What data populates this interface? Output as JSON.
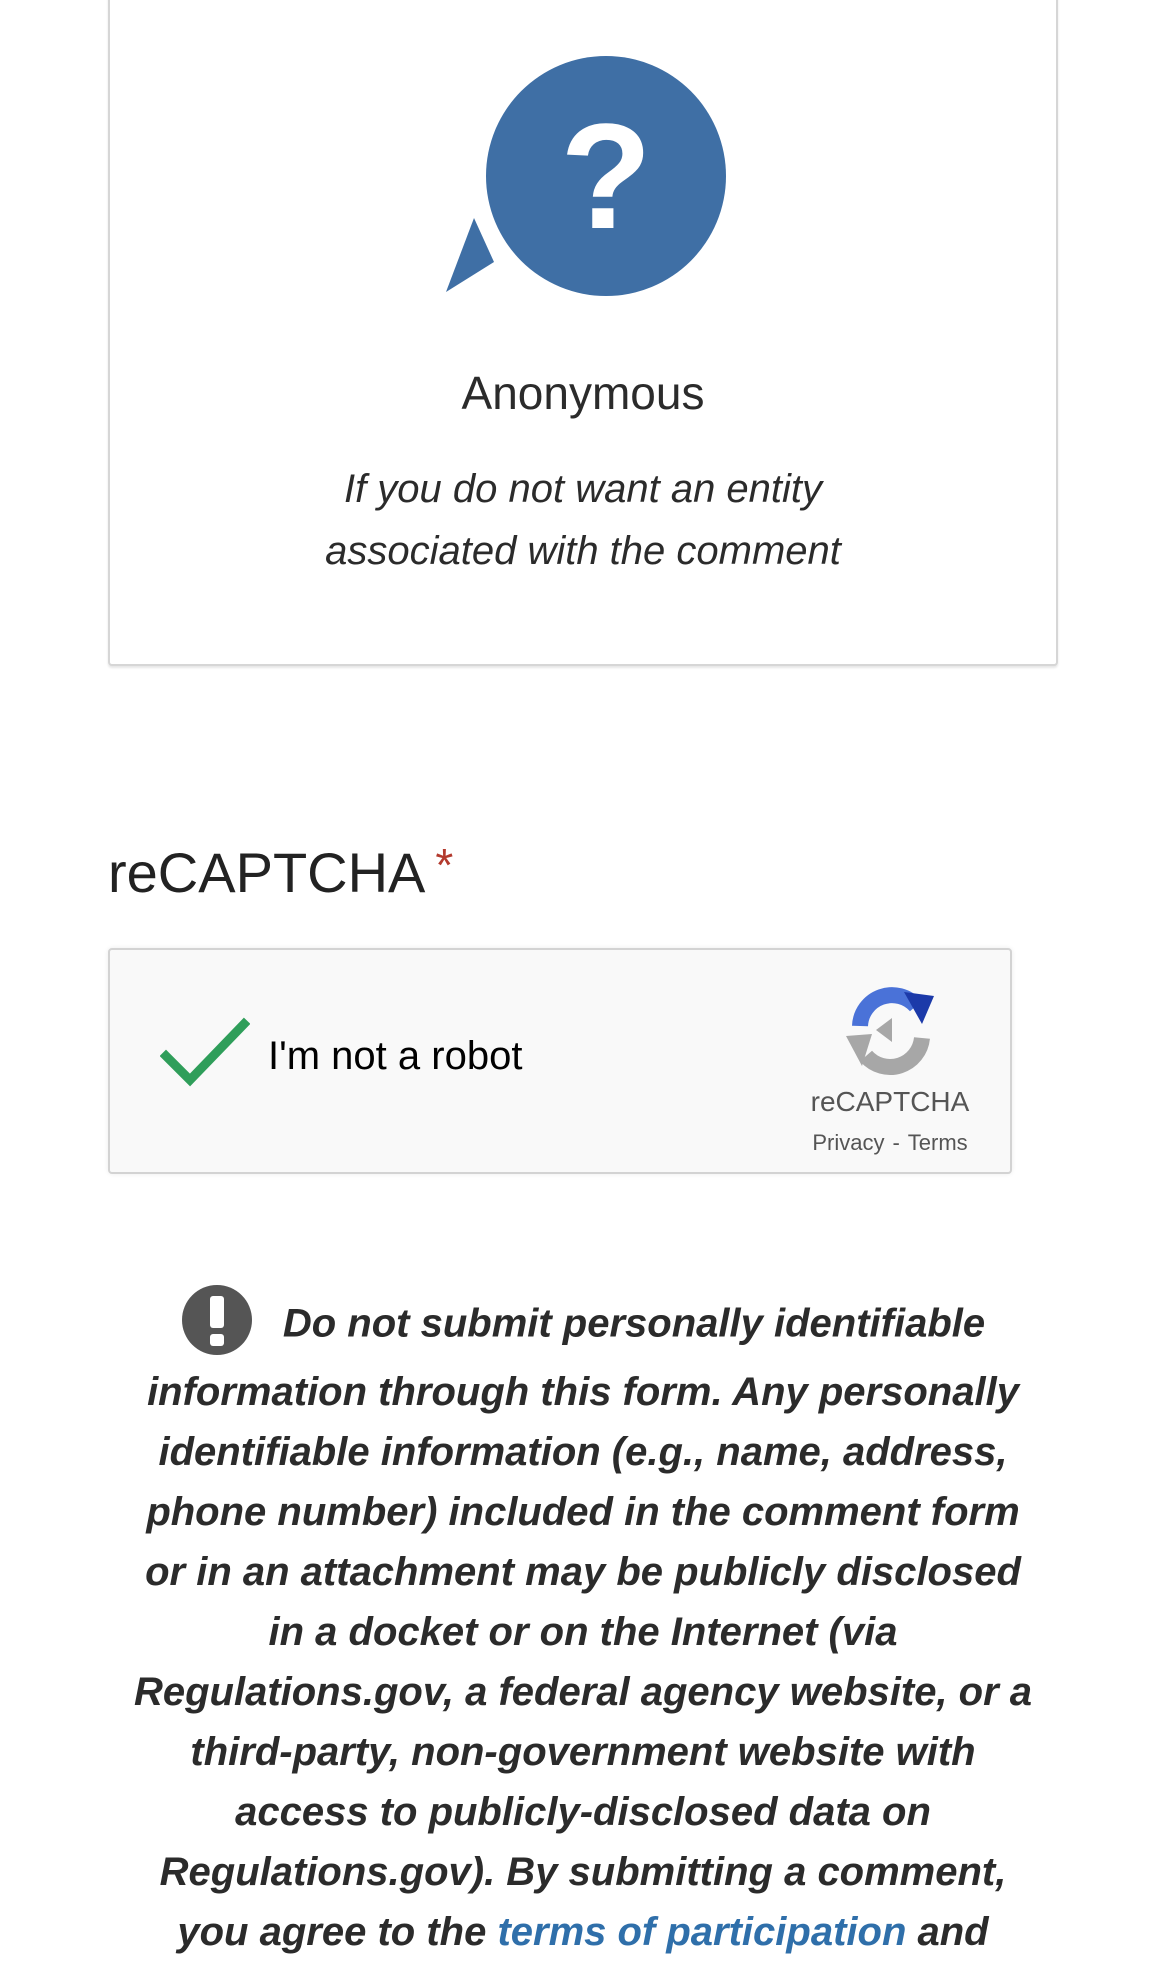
{
  "anonymous_option": {
    "icon": "question-speech-bubble-icon",
    "icon_color": "#3f6fa5",
    "title": "Anonymous",
    "description_line1": "If you do not want an entity",
    "description_line2": "associated with the comment"
  },
  "recaptcha_section": {
    "heading": "reCAPTCHA",
    "required_marker": "*",
    "checkbox_label": "I'm not a robot",
    "checked": true,
    "check_color": "#2f9e5a",
    "brand": "reCAPTCHA",
    "privacy_link": "Privacy",
    "separator": "-",
    "terms_link": "Terms"
  },
  "warning": {
    "icon": "exclamation-circle-icon",
    "line1": "Do not submit personally identifiable",
    "line2": "information through this form. Any personally",
    "line3": "identifiable information (e.g., name, address,",
    "line4": "phone number) included in the comment form",
    "line5": "or in an attachment may be publicly disclosed",
    "line6": "in a docket or on the Internet (via",
    "line7": "Regulations.gov, a federal agency website, or a",
    "line8": "third-party, non-government website with",
    "line9": "access to publicly-disclosed data on",
    "line10": "Regulations.gov). By submitting a comment,",
    "line11_prefix": "you agree to the ",
    "line11_link": "terms of participation",
    "line11_suffix": " and",
    "link_color": "#2f6faa"
  }
}
